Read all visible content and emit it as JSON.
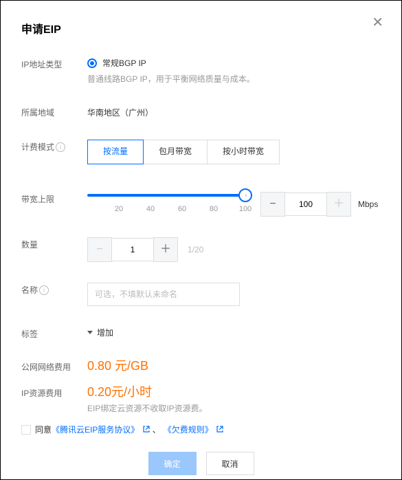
{
  "dialog": {
    "title": "申请EIP"
  },
  "ip_type": {
    "label": "IP地址类型",
    "option_label": "常规BGP IP",
    "option_desc": "普通线路BGP IP，用于平衡网络质量与成本。"
  },
  "region": {
    "label": "所属地域",
    "value": "华南地区（广州）"
  },
  "billing": {
    "label": "计费模式",
    "options": [
      {
        "label": "按流量",
        "active": true
      },
      {
        "label": "包月带宽",
        "active": false
      },
      {
        "label": "按小时带宽",
        "active": false
      }
    ]
  },
  "bandwidth": {
    "label": "带宽上限",
    "ticks": [
      "20",
      "40",
      "60",
      "80",
      "100"
    ],
    "value": "100",
    "unit": "Mbps"
  },
  "quantity": {
    "label": "数量",
    "value": "1",
    "hint": "1/20"
  },
  "name_field": {
    "label": "名称",
    "placeholder": "可选，不填默认未命名"
  },
  "tags": {
    "label": "标签",
    "action": "增加"
  },
  "net_fee": {
    "label": "公网网络费用",
    "value": "0.80 元/GB"
  },
  "res_fee": {
    "label": "IP资源费用",
    "value": "0.20元/小时",
    "note": "EIP绑定云资源不收取IP资源费。"
  },
  "agree": {
    "text": "同意",
    "link1": "《腾讯云EIP服务协议》",
    "sep": "、",
    "link2": "《欠费规则》"
  },
  "footer": {
    "ok": "确定",
    "cancel": "取消"
  }
}
